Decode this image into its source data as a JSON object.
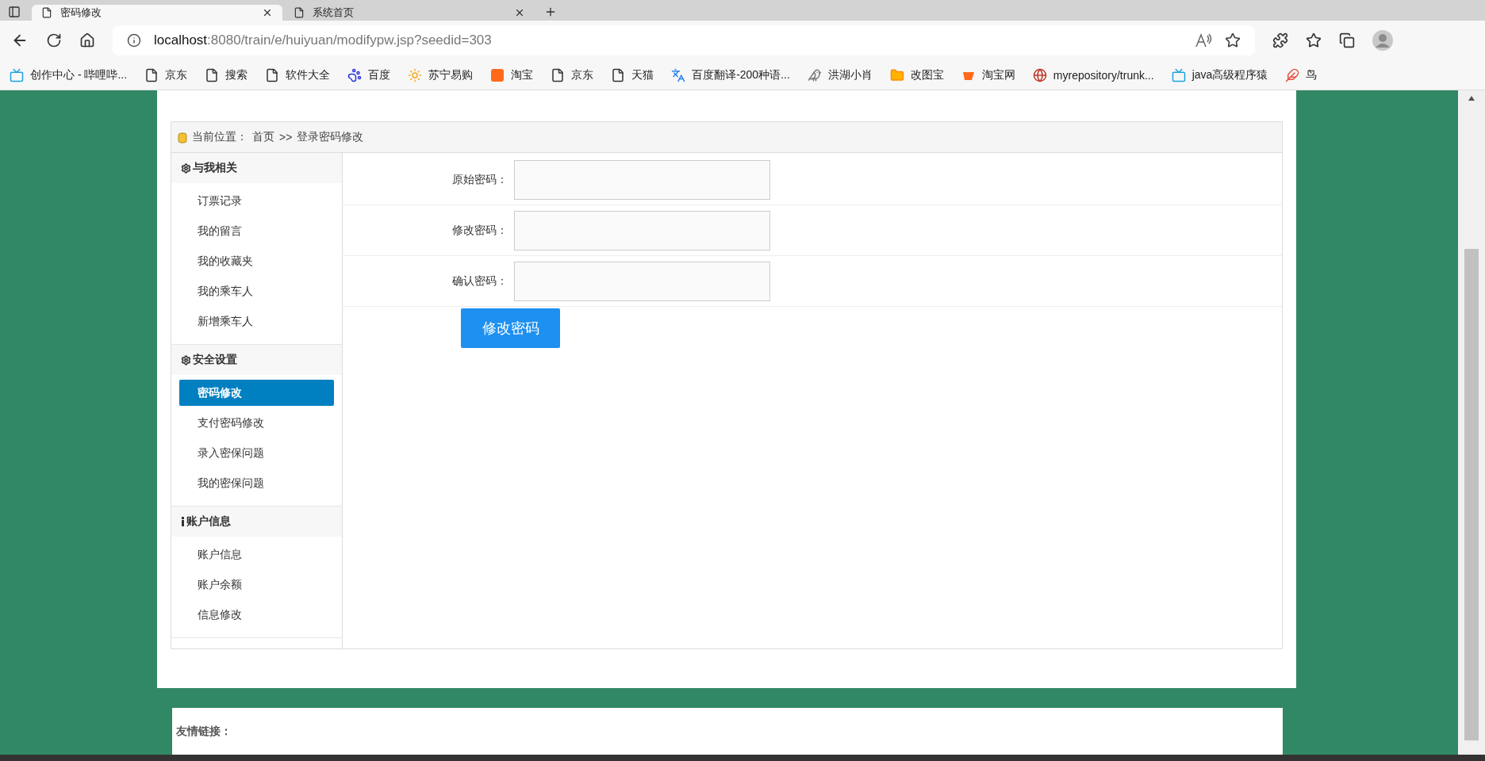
{
  "browser": {
    "tabs": [
      {
        "title": "密码修改",
        "selected": true
      },
      {
        "title": "系统首页",
        "selected": false
      }
    ],
    "url": {
      "host": "localhost",
      "path": ":8080/train/e/huiyuan/modifypw.jsp?seedid=303"
    },
    "bookmarks": [
      {
        "label": "创作中心 - 哔哩哔...",
        "kind": "tv"
      },
      {
        "label": "京东",
        "kind": "page"
      },
      {
        "label": "搜索",
        "kind": "page"
      },
      {
        "label": "软件大全",
        "kind": "page"
      },
      {
        "label": "百度",
        "kind": "paw"
      },
      {
        "label": "苏宁易购",
        "kind": "sun"
      },
      {
        "label": "淘宝",
        "kind": "orange"
      },
      {
        "label": "京东",
        "kind": "page"
      },
      {
        "label": "天猫",
        "kind": "page"
      },
      {
        "label": "百度翻译-200种语...",
        "kind": "translate"
      },
      {
        "label": "洪湖小肖",
        "kind": "bird"
      },
      {
        "label": "改图宝",
        "kind": "folder"
      },
      {
        "label": "淘宝网",
        "kind": "orange-plain"
      },
      {
        "label": "myrepository/trunk...",
        "kind": "globe"
      },
      {
        "label": "java高级程序猿",
        "kind": "tv"
      },
      {
        "label": "鸟",
        "kind": "swallow"
      }
    ]
  },
  "breadcrumb": {
    "label": "当前位置：",
    "home": "首页",
    "separator": ">>",
    "current": "登录密码修改"
  },
  "sidebar": {
    "groups": [
      {
        "title": "与我相关",
        "kind": "gear",
        "items": [
          {
            "label": "订票记录",
            "selected": false
          },
          {
            "label": "我的留言",
            "selected": false
          },
          {
            "label": "我的收藏夹",
            "selected": false
          },
          {
            "label": "我的乘车人",
            "selected": false
          },
          {
            "label": "新增乘车人",
            "selected": false
          }
        ]
      },
      {
        "title": "安全设置",
        "kind": "gear",
        "items": [
          {
            "label": "密码修改",
            "selected": true
          },
          {
            "label": "支付密码修改",
            "selected": false
          },
          {
            "label": "录入密保问题",
            "selected": false
          },
          {
            "label": "我的密保问题",
            "selected": false
          }
        ]
      },
      {
        "title": "账户信息",
        "kind": "info",
        "items": [
          {
            "label": "账户信息",
            "selected": false
          },
          {
            "label": "账户余额",
            "selected": false
          },
          {
            "label": "信息修改",
            "selected": false
          }
        ]
      }
    ]
  },
  "form": {
    "fields": [
      {
        "label": "原始密码："
      },
      {
        "label": "修改密码："
      },
      {
        "label": "确认密码："
      }
    ],
    "submit": "修改密码"
  },
  "footer": {
    "title": "友情链接："
  }
}
